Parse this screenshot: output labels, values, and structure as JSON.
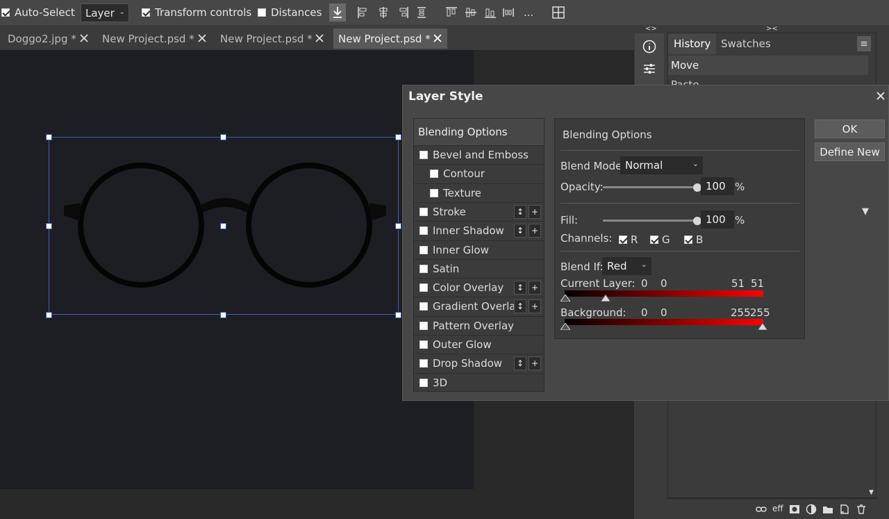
{
  "toolbar": {
    "auto_select": {
      "label": "Auto-Select",
      "checked": true
    },
    "target_select": {
      "value": "Layer"
    },
    "transform_controls": {
      "label": "Transform controls",
      "checked": true
    },
    "distances": {
      "label": "Distances",
      "checked": false
    },
    "more_label": "..."
  },
  "tabs": [
    {
      "label": "Doggo2.jpg *"
    },
    {
      "label": "New Project.psd *"
    },
    {
      "label": "New Project.psd *"
    },
    {
      "label": "New Project.psd *"
    }
  ],
  "side_panel": {
    "collapse_left": "<>",
    "collapse_right": "><",
    "tabs": [
      "History",
      "Swatches"
    ],
    "history_items": [
      "Move",
      "Paste"
    ]
  },
  "dialog": {
    "title": "Layer Style",
    "list_header": "Blending Options",
    "styles": [
      {
        "label": "Bevel and Emboss",
        "checked": false,
        "sub": false
      },
      {
        "label": "Contour",
        "checked": false,
        "sub": true
      },
      {
        "label": "Texture",
        "checked": false,
        "sub": true
      },
      {
        "label": "Stroke",
        "checked": false,
        "sub": false,
        "buttons": true
      },
      {
        "label": "Inner Shadow",
        "checked": false,
        "sub": false,
        "buttons": true
      },
      {
        "label": "Inner Glow",
        "checked": false,
        "sub": false
      },
      {
        "label": "Satin",
        "checked": false,
        "sub": false
      },
      {
        "label": "Color Overlay",
        "checked": false,
        "sub": false,
        "buttons": true
      },
      {
        "label": "Gradient Overlay",
        "checked": false,
        "sub": false,
        "buttons": true
      },
      {
        "label": "Pattern Overlay",
        "checked": false,
        "sub": false
      },
      {
        "label": "Outer Glow",
        "checked": false,
        "sub": false
      },
      {
        "label": "Drop Shadow",
        "checked": false,
        "sub": false,
        "buttons": true
      },
      {
        "label": "3D",
        "checked": false,
        "sub": false
      }
    ],
    "options": {
      "heading": "Blending Options",
      "blend_mode_label": "Blend Mode:",
      "blend_mode_value": "Normal",
      "opacity_label": "Opacity:",
      "opacity_value": "100",
      "fill_label": "Fill:",
      "fill_value": "100",
      "percent": "%",
      "channels_label": "Channels:",
      "channels": [
        {
          "label": "R",
          "checked": true
        },
        {
          "label": "G",
          "checked": true
        },
        {
          "label": "B",
          "checked": true
        }
      ],
      "blend_if_label": "Blend If:",
      "blend_if_value": "Red",
      "current_layer_label": "Current Layer:",
      "current_layer_values": [
        "0",
        "0",
        "51",
        "51"
      ],
      "background_label": "Background:",
      "background_values": [
        "0",
        "0",
        "255",
        "255"
      ]
    },
    "ok_label": "OK",
    "define_new_label": "Define New",
    "expand_arrow": "▼"
  },
  "colors": {
    "accent_selection": "#3f64b8",
    "dialog_bg": "#474747",
    "canvas_bg": "#1d1e24",
    "gradient_red": "#ff0000"
  }
}
